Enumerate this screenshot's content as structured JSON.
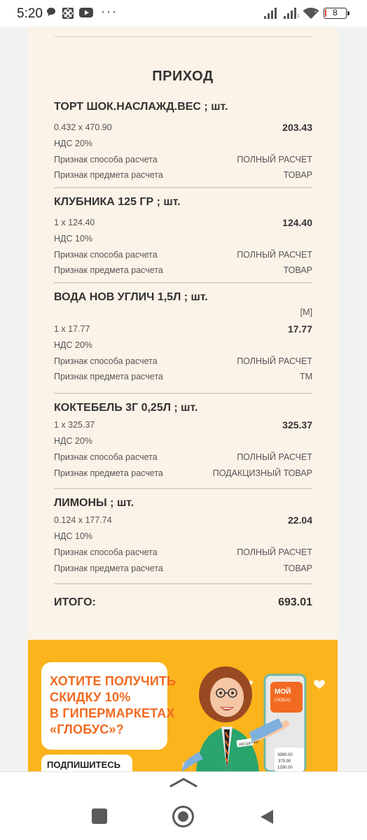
{
  "status_bar": {
    "time": "5:20",
    "icons": [
      "chat-bubble-icon",
      "app-icon",
      "youtube-icon",
      "more-dots-icon",
      "signal-icon",
      "signal-icon",
      "wifi-icon",
      "battery-icon"
    ],
    "more": "···",
    "battery": "8",
    "battery_level": 0.08,
    "battery_color": "#e53935"
  },
  "receipt": {
    "heading": "ПРИХОД",
    "items": [
      {
        "title": "ТОРТ ШОК.НАСЛАЖД.ВЕС ; шт.",
        "qty_price": "0.432 x 470.90",
        "sum": "203.43",
        "vat": "НДС 20%",
        "method_label": "Признак способа расчета",
        "method_value": "ПОЛНЫЙ РАСЧЕТ",
        "subject_label": "Признак предмета расчета",
        "subject_value": "ТОВАР"
      },
      {
        "title": "КЛУБНИКА 125 ГР ; шт.",
        "qty_price": "1 x 124.40",
        "sum": "124.40",
        "vat": "НДС 10%",
        "method_label": "Признак способа расчета",
        "method_value": "ПОЛНЫЙ РАСЧЕТ",
        "subject_label": "Признак предмета расчета",
        "subject_value": "ТОВАР"
      },
      {
        "title": "ВОДА НОВ УГЛИЧ 1,5Л ; шт.",
        "mark": "[M]",
        "qty_price": "1 x 17.77",
        "sum": "17.77",
        "vat": "НДС 20%",
        "method_label": "Признак способа расчета",
        "method_value": "ПОЛНЫЙ РАСЧЕТ",
        "subject_label": "Признак предмета расчета",
        "subject_value": "ТМ"
      },
      {
        "title": "КОКТЕБЕЛЬ 3Г 0,25Л ; шт.",
        "qty_price": "1 x 325.37",
        "sum": "325.37",
        "vat": "НДС 20%",
        "method_label": "Признак способа расчета",
        "method_value": "ПОЛНЫЙ РАСЧЕТ",
        "subject_label": "Признак предмета расчета",
        "subject_value": "ПОДАКЦИЗНЫЙ ТОВАР"
      },
      {
        "title": "ЛИМОНЫ ; шт.",
        "qty_price": "0.124 x 177.74",
        "sum": "22.04",
        "vat": "НДС 10%",
        "method_label": "Признак способа расчета",
        "method_value": "ПОЛНЫЙ РАСЧЕТ",
        "subject_label": "Признак предмета расчета",
        "subject_value": "ТОВАР"
      }
    ],
    "total_label": "ИТОГО:",
    "total_value": "693.01"
  },
  "banner": {
    "promo_lines": [
      "ХОТИТЕ ПОЛУЧИТЬ",
      "СКИДКУ 10%",
      "В ГИПЕРМАРКЕТАХ",
      "«ГЛОБУС»?"
    ],
    "subscribe": "ПОДПИШИТЕСЬ",
    "logo_text_1": "МОЙ",
    "logo_text_2": "ГЛОБУС",
    "badge": "ЗВЕЗДОЧКИ",
    "prices": [
      "3990.00",
      "379.90",
      "1290.00"
    ],
    "colors": {
      "background": "#fbb41c",
      "accent": "#f26a21"
    }
  },
  "nav": {
    "icons": [
      "chevron-up-icon",
      "recents-square-icon",
      "home-circle-icon",
      "back-triangle-icon"
    ]
  }
}
